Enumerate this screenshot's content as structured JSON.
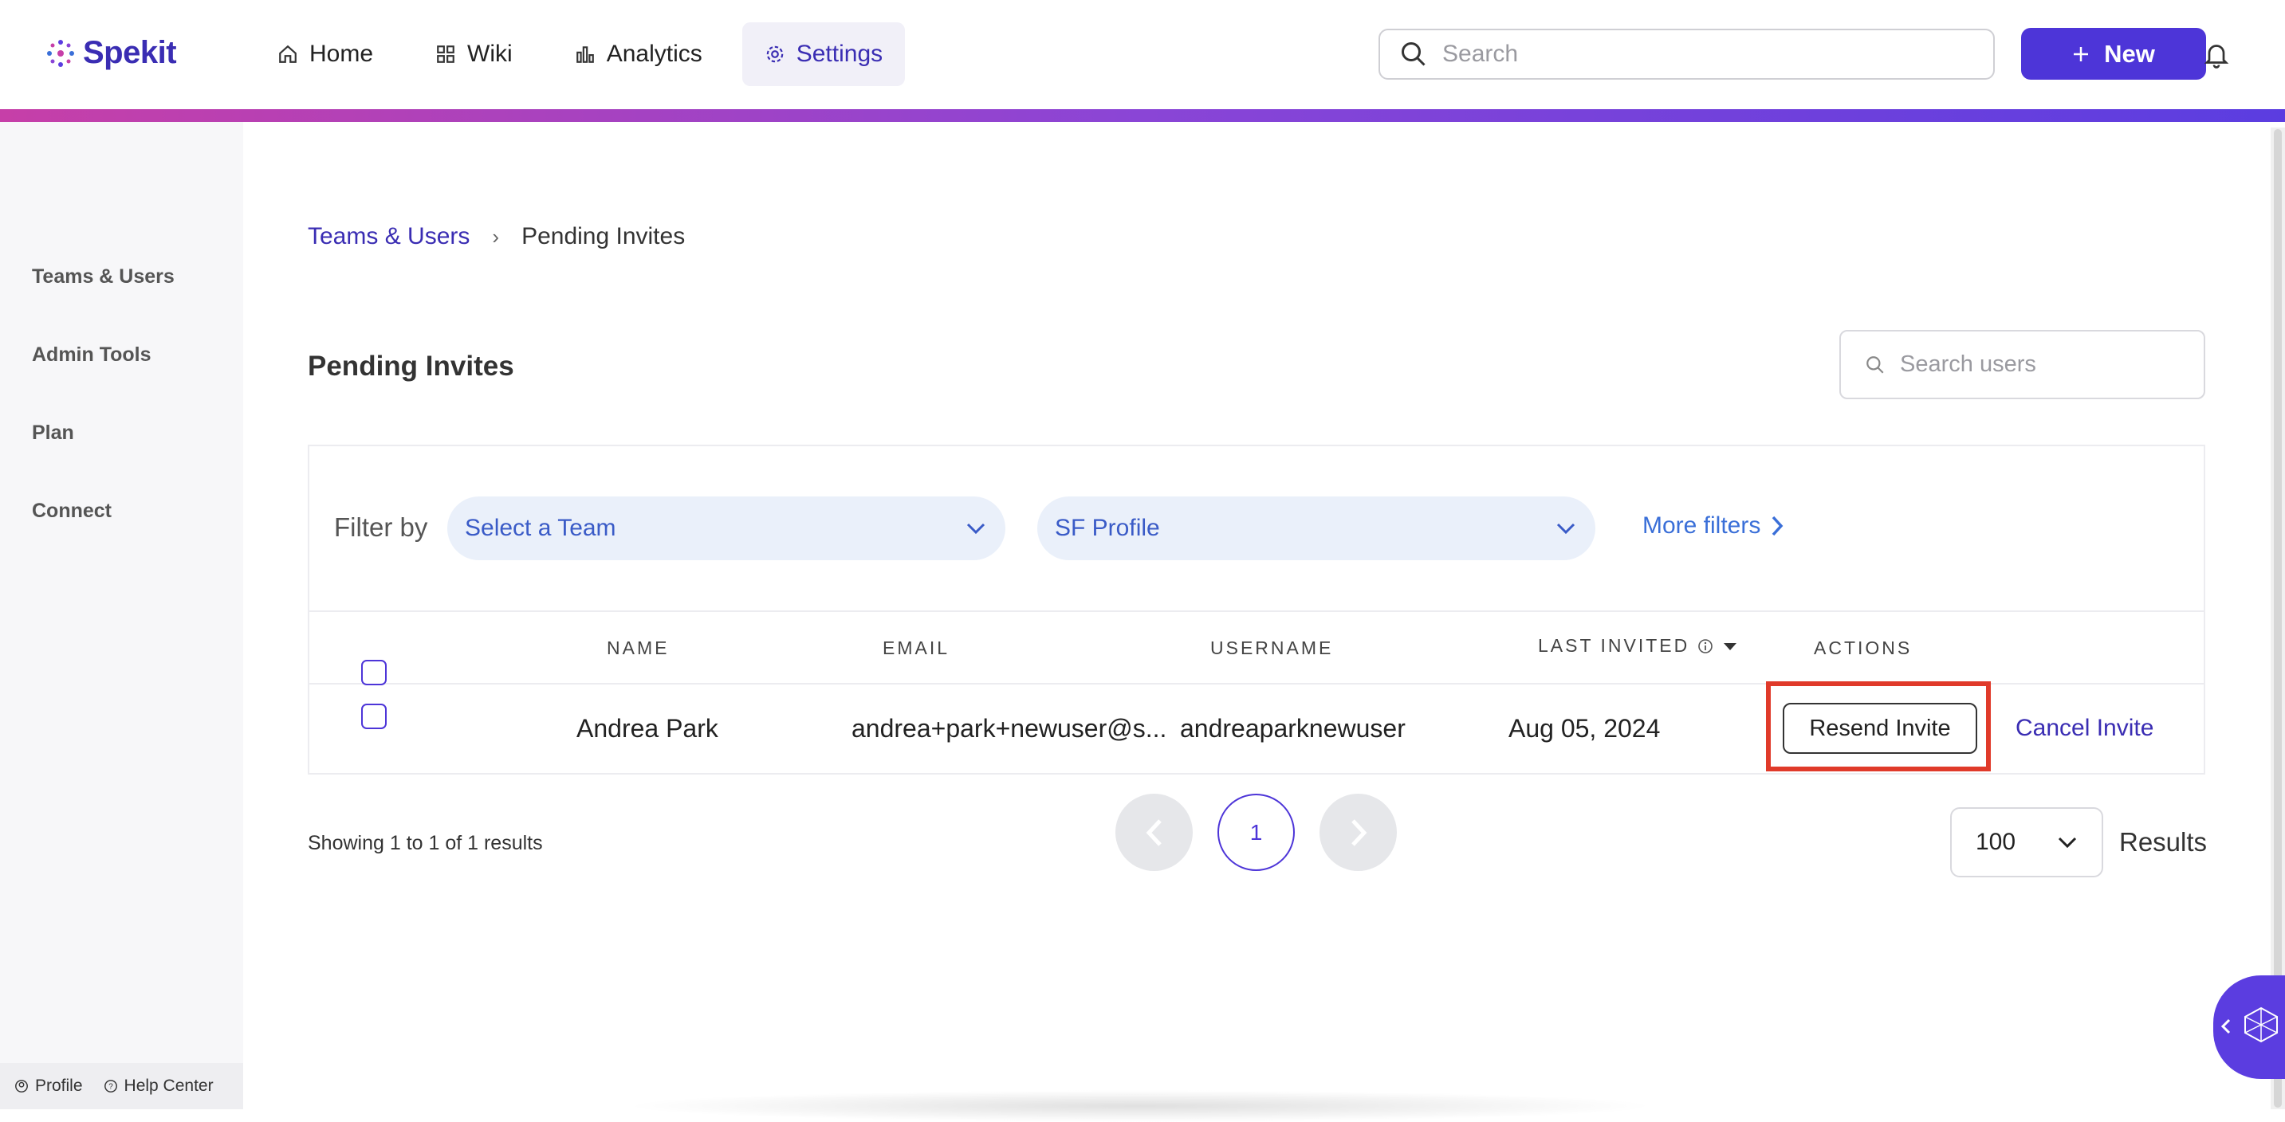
{
  "app": {
    "name": "Spekit"
  },
  "nav": {
    "items": [
      {
        "label": "Home",
        "icon": "home-icon"
      },
      {
        "label": "Wiki",
        "icon": "grid-icon"
      },
      {
        "label": "Analytics",
        "icon": "chart-icon"
      },
      {
        "label": "Settings",
        "icon": "gear-icon",
        "active": true
      }
    ]
  },
  "header": {
    "search_placeholder": "Search",
    "new_button": "New"
  },
  "sidebar": {
    "items": [
      {
        "label": "Teams & Users"
      },
      {
        "label": "Admin Tools"
      },
      {
        "label": "Plan"
      },
      {
        "label": "Connect"
      }
    ],
    "footer": {
      "profile": "Profile",
      "help": "Help Center"
    }
  },
  "breadcrumb": {
    "parent": "Teams & Users",
    "separator": "›",
    "current": "Pending Invites"
  },
  "page": {
    "title": "Pending Invites",
    "search_placeholder": "Search users"
  },
  "filters": {
    "label": "Filter by",
    "team_select": "Select a Team",
    "profile_select": "SF Profile",
    "more": "More filters"
  },
  "table": {
    "columns": {
      "name": "NAME",
      "email": "EMAIL",
      "username": "USERNAME",
      "last_invited": "LAST INVITED",
      "actions": "ACTIONS"
    },
    "rows": [
      {
        "name": "Andrea Park",
        "email": "andrea+park+newuser@s...",
        "username": "andreaparknewuser",
        "last_invited": "Aug 05, 2024",
        "resend": "Resend Invite",
        "cancel": "Cancel Invite"
      }
    ]
  },
  "pagination": {
    "showing": "Showing 1 to 1 of 1 results",
    "current_page": "1",
    "page_size": "100",
    "results_label": "Results"
  },
  "colors": {
    "brand": "#4d35d8",
    "highlight": "#e03a2a",
    "link": "#3a2db3"
  }
}
